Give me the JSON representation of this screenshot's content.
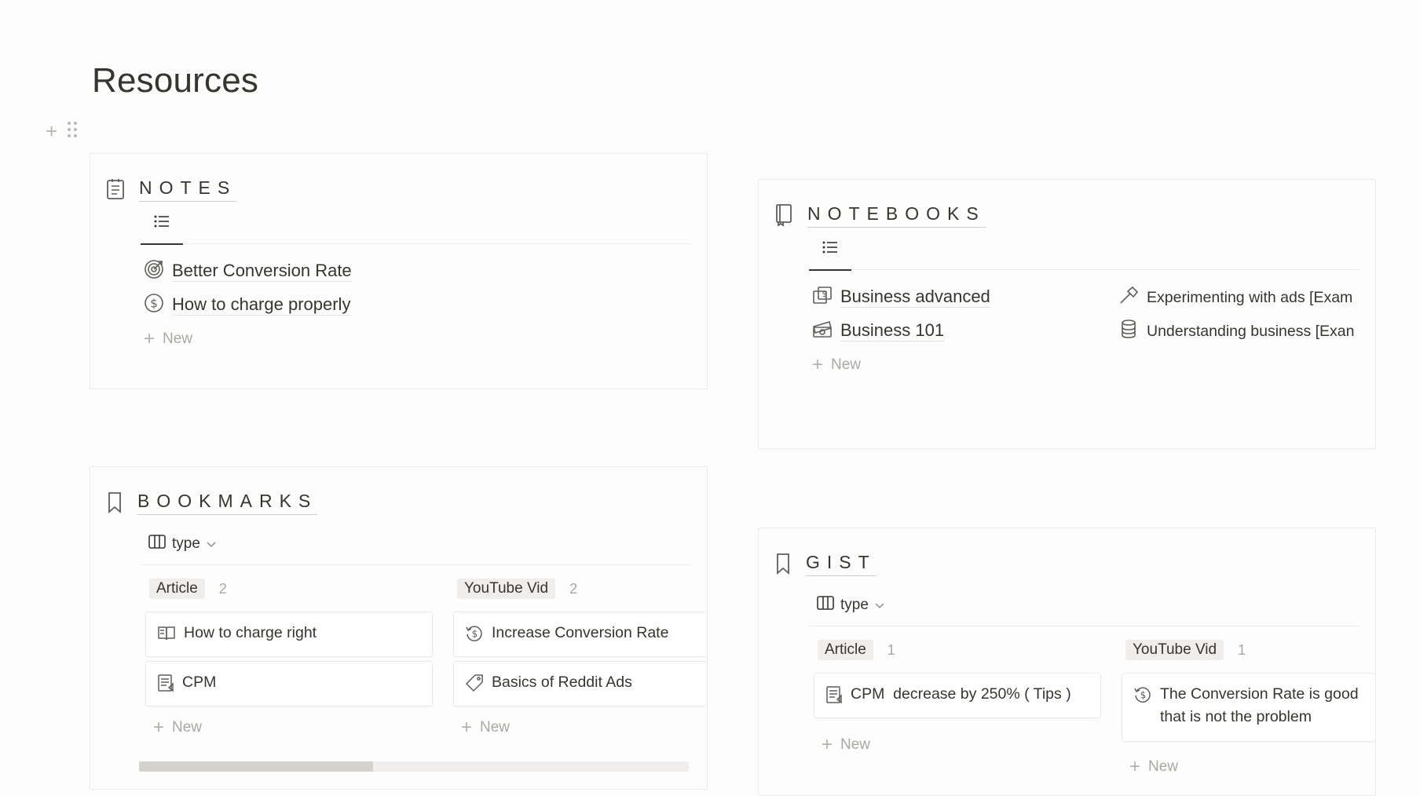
{
  "page": {
    "title": "Resources"
  },
  "notes": {
    "title": "NOTES",
    "items": [
      {
        "label": "Better Conversion Rate",
        "icon": "target-icon"
      },
      {
        "label": "How to charge properly",
        "icon": "dollar-circle-icon"
      }
    ],
    "new_label": "New"
  },
  "notebooks": {
    "title": "NOTEBOOKS",
    "items_col1": [
      {
        "label": "Business advanced",
        "icon": "money-icon"
      },
      {
        "label": "Business 101",
        "icon": "cash-icon"
      }
    ],
    "items_col2": [
      {
        "label": "Experimenting with ads [Exam",
        "icon": "hammer-icon"
      },
      {
        "label": "Understanding business [Exan",
        "icon": "database-icon"
      }
    ],
    "new_label": "New"
  },
  "bookmarks": {
    "title": "BOOKMARKS",
    "view_label": "type",
    "groups": [
      {
        "name": "Article",
        "count": "2",
        "cards": [
          {
            "label": "How to charge right",
            "icon": "book-icon"
          },
          {
            "label": "CPM",
            "icon": "document-icon"
          }
        ]
      },
      {
        "name": "YouTube Vid",
        "count": "2",
        "cards": [
          {
            "label": "Increase Conversion Rate",
            "icon": "dollar-refresh-icon"
          },
          {
            "label": "Basics of Reddit Ads",
            "icon": "tag-icon"
          }
        ]
      }
    ],
    "new_label": "New"
  },
  "gist": {
    "title": "GIST",
    "view_label": "type",
    "groups": [
      {
        "name": "Article",
        "count": "1",
        "cards": [
          {
            "label": "CPM  decrease by 250% ( Tips )",
            "icon": "document-icon"
          }
        ]
      },
      {
        "name": "YouTube Vid",
        "count": "1",
        "cards": [
          {
            "label": "The Conversion Rate is good that is not the problem",
            "icon": "dollar-refresh-icon"
          }
        ]
      }
    ],
    "new_label": "New"
  }
}
